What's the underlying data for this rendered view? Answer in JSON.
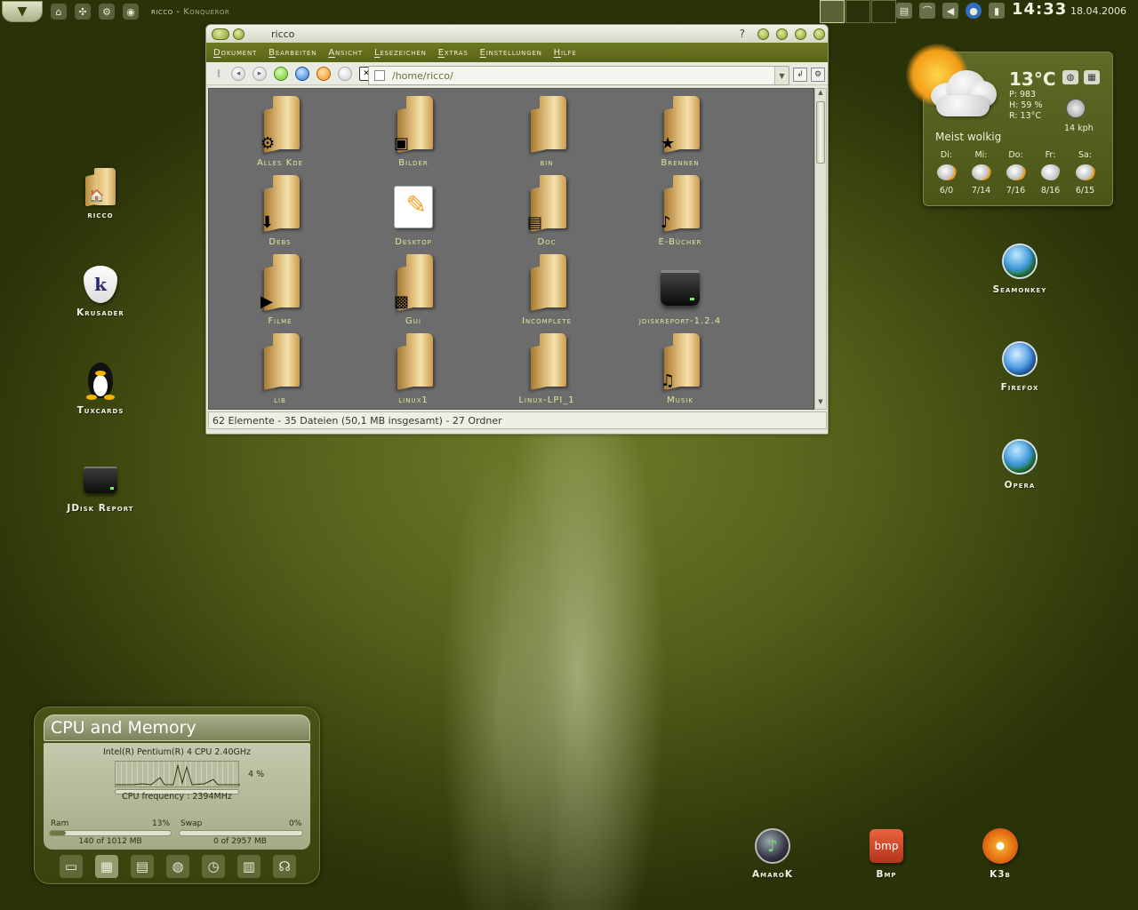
{
  "panel": {
    "task_title": "ricco",
    "task_app": "Konqueror",
    "clock": "14:33",
    "date": "18.04.2006"
  },
  "desktop_left": [
    {
      "label": "ricco",
      "icon": "home-folder-icon"
    },
    {
      "label": "Krusader",
      "icon": "krusader-icon"
    },
    {
      "label": "Tuxcards",
      "icon": "tux-icon"
    },
    {
      "label": "JDisk Report",
      "icon": "harddisk-icon"
    }
  ],
  "desktop_right": [
    {
      "label": "Seamonkey",
      "icon": "globe-icon"
    },
    {
      "label": "Firefox",
      "icon": "firefox-icon"
    },
    {
      "label": "Opera",
      "icon": "opera-globe-icon"
    }
  ],
  "dock_bottom": [
    {
      "label": "AmaroK",
      "icon": "amarok-icon"
    },
    {
      "label": "Bmp",
      "icon": "bmp-icon",
      "badge": "bmp"
    },
    {
      "label": "K3b",
      "icon": "k3b-icon"
    }
  ],
  "window": {
    "title": "ricco",
    "help_glyph": "?",
    "menu": [
      "Dokument",
      "Bearbeiten",
      "Ansicht",
      "Lesezeichen",
      "Extras",
      "Einstellungen",
      "Hilfe"
    ],
    "url": "/home/ricco/",
    "files": [
      {
        "name": "Alles Kde",
        "type": "folder"
      },
      {
        "name": "Bilder",
        "type": "folder"
      },
      {
        "name": "bin",
        "type": "folder"
      },
      {
        "name": "Brennen",
        "type": "folder"
      },
      {
        "name": "Debs",
        "type": "folder"
      },
      {
        "name": "Desktop",
        "type": "desktop"
      },
      {
        "name": "Doc",
        "type": "folder"
      },
      {
        "name": "E-Bücher",
        "type": "folder"
      },
      {
        "name": "Filme",
        "type": "folder"
      },
      {
        "name": "Gui",
        "type": "folder"
      },
      {
        "name": "Incomplete",
        "type": "folder"
      },
      {
        "name": "jdiskreport-1.2.4",
        "type": "drive"
      },
      {
        "name": "lib",
        "type": "folder"
      },
      {
        "name": "linux1",
        "type": "folder"
      },
      {
        "name": "Linux-LPI_1",
        "type": "folder"
      },
      {
        "name": "Musik",
        "type": "folder"
      }
    ],
    "status": "62 Elemente - 35 Dateien (50,1 MB insgesamt) - 27 Ordner"
  },
  "weather": {
    "temp": "13°C",
    "pressure": "P: 983",
    "humidity": "H: 59 %",
    "realfeel": "R: 13°C",
    "wind": "14 kph",
    "description": "Meist wolkig",
    "forecast": [
      {
        "day": "Di:",
        "range": "6/0"
      },
      {
        "day": "Mi:",
        "range": "7/14"
      },
      {
        "day": "Do:",
        "range": "7/16"
      },
      {
        "day": "Fr:",
        "range": "8/16"
      },
      {
        "day": "Sa:",
        "range": "6/15"
      }
    ]
  },
  "cpu": {
    "title": "CPU and Memory",
    "model": "Intel(R) Pentium(R) 4 CPU 2.40GHz",
    "load": "4 %",
    "frequency": "CPU frequency : 2394MHz",
    "ram_label": "Ram",
    "ram_pct": "13%",
    "ram_fraction": 0.13,
    "ram_value": "140 of 1012 MB",
    "swap_label": "Swap",
    "swap_pct": "0%",
    "swap_fraction": 0.0,
    "swap_value": "0 of 2957 MB"
  }
}
